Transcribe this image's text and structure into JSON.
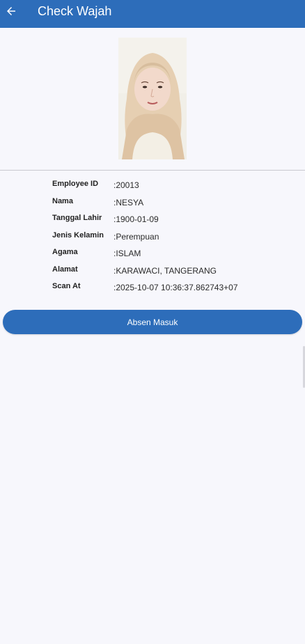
{
  "appbar": {
    "title": "Check Wajah",
    "back_icon": "arrow-left-icon",
    "color": "#2d6dba"
  },
  "profile": {
    "photo_alt": "employee-face-photo"
  },
  "details": {
    "employee_id": {
      "label": "Employee ID",
      "value": ":20013"
    },
    "nama": {
      "label": "Nama",
      "value": ":NESYA"
    },
    "tanggal_lahir": {
      "label": "Tanggal Lahir",
      "value": ":1900-01-09"
    },
    "jenis_kelamin": {
      "label": "Jenis Kelamin",
      "value": ":Perempuan"
    },
    "agama": {
      "label": "Agama",
      "value": ":ISLAM"
    },
    "alamat": {
      "label": "Alamat",
      "value": ":KARAWACI, TANGERANG"
    },
    "scan_at": {
      "label": "Scan At",
      "value": ":2025-10-07 10:36:37.862743+07"
    }
  },
  "actions": {
    "absen_label": "Absen Masuk",
    "button_color": "#2d6dba"
  }
}
